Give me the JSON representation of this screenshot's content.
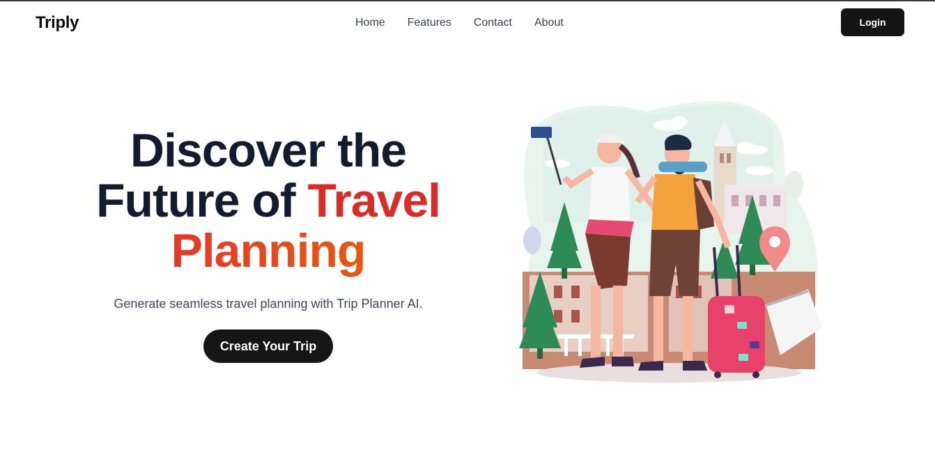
{
  "brand": {
    "name": "Triply"
  },
  "nav": {
    "items": [
      {
        "label": "Home"
      },
      {
        "label": "Features"
      },
      {
        "label": "Contact"
      },
      {
        "label": "About"
      }
    ],
    "login_label": "Login"
  },
  "hero": {
    "headline_line1": "Discover the",
    "headline_line2_dark": "Future of ",
    "headline_line2_accent": "Travel",
    "headline_line3_accent": "Planning",
    "subtitle": "Generate seamless travel planning with Trip Planner AI.",
    "cta_label": "Create Your Trip"
  },
  "colors": {
    "text_dark": "#131c2e",
    "accent_red": "#dc2626",
    "accent_orange": "#ea580c",
    "button_bg": "#161616"
  },
  "icons": [
    "travel-illustration",
    "location-pin-icon",
    "cloud-icon"
  ]
}
